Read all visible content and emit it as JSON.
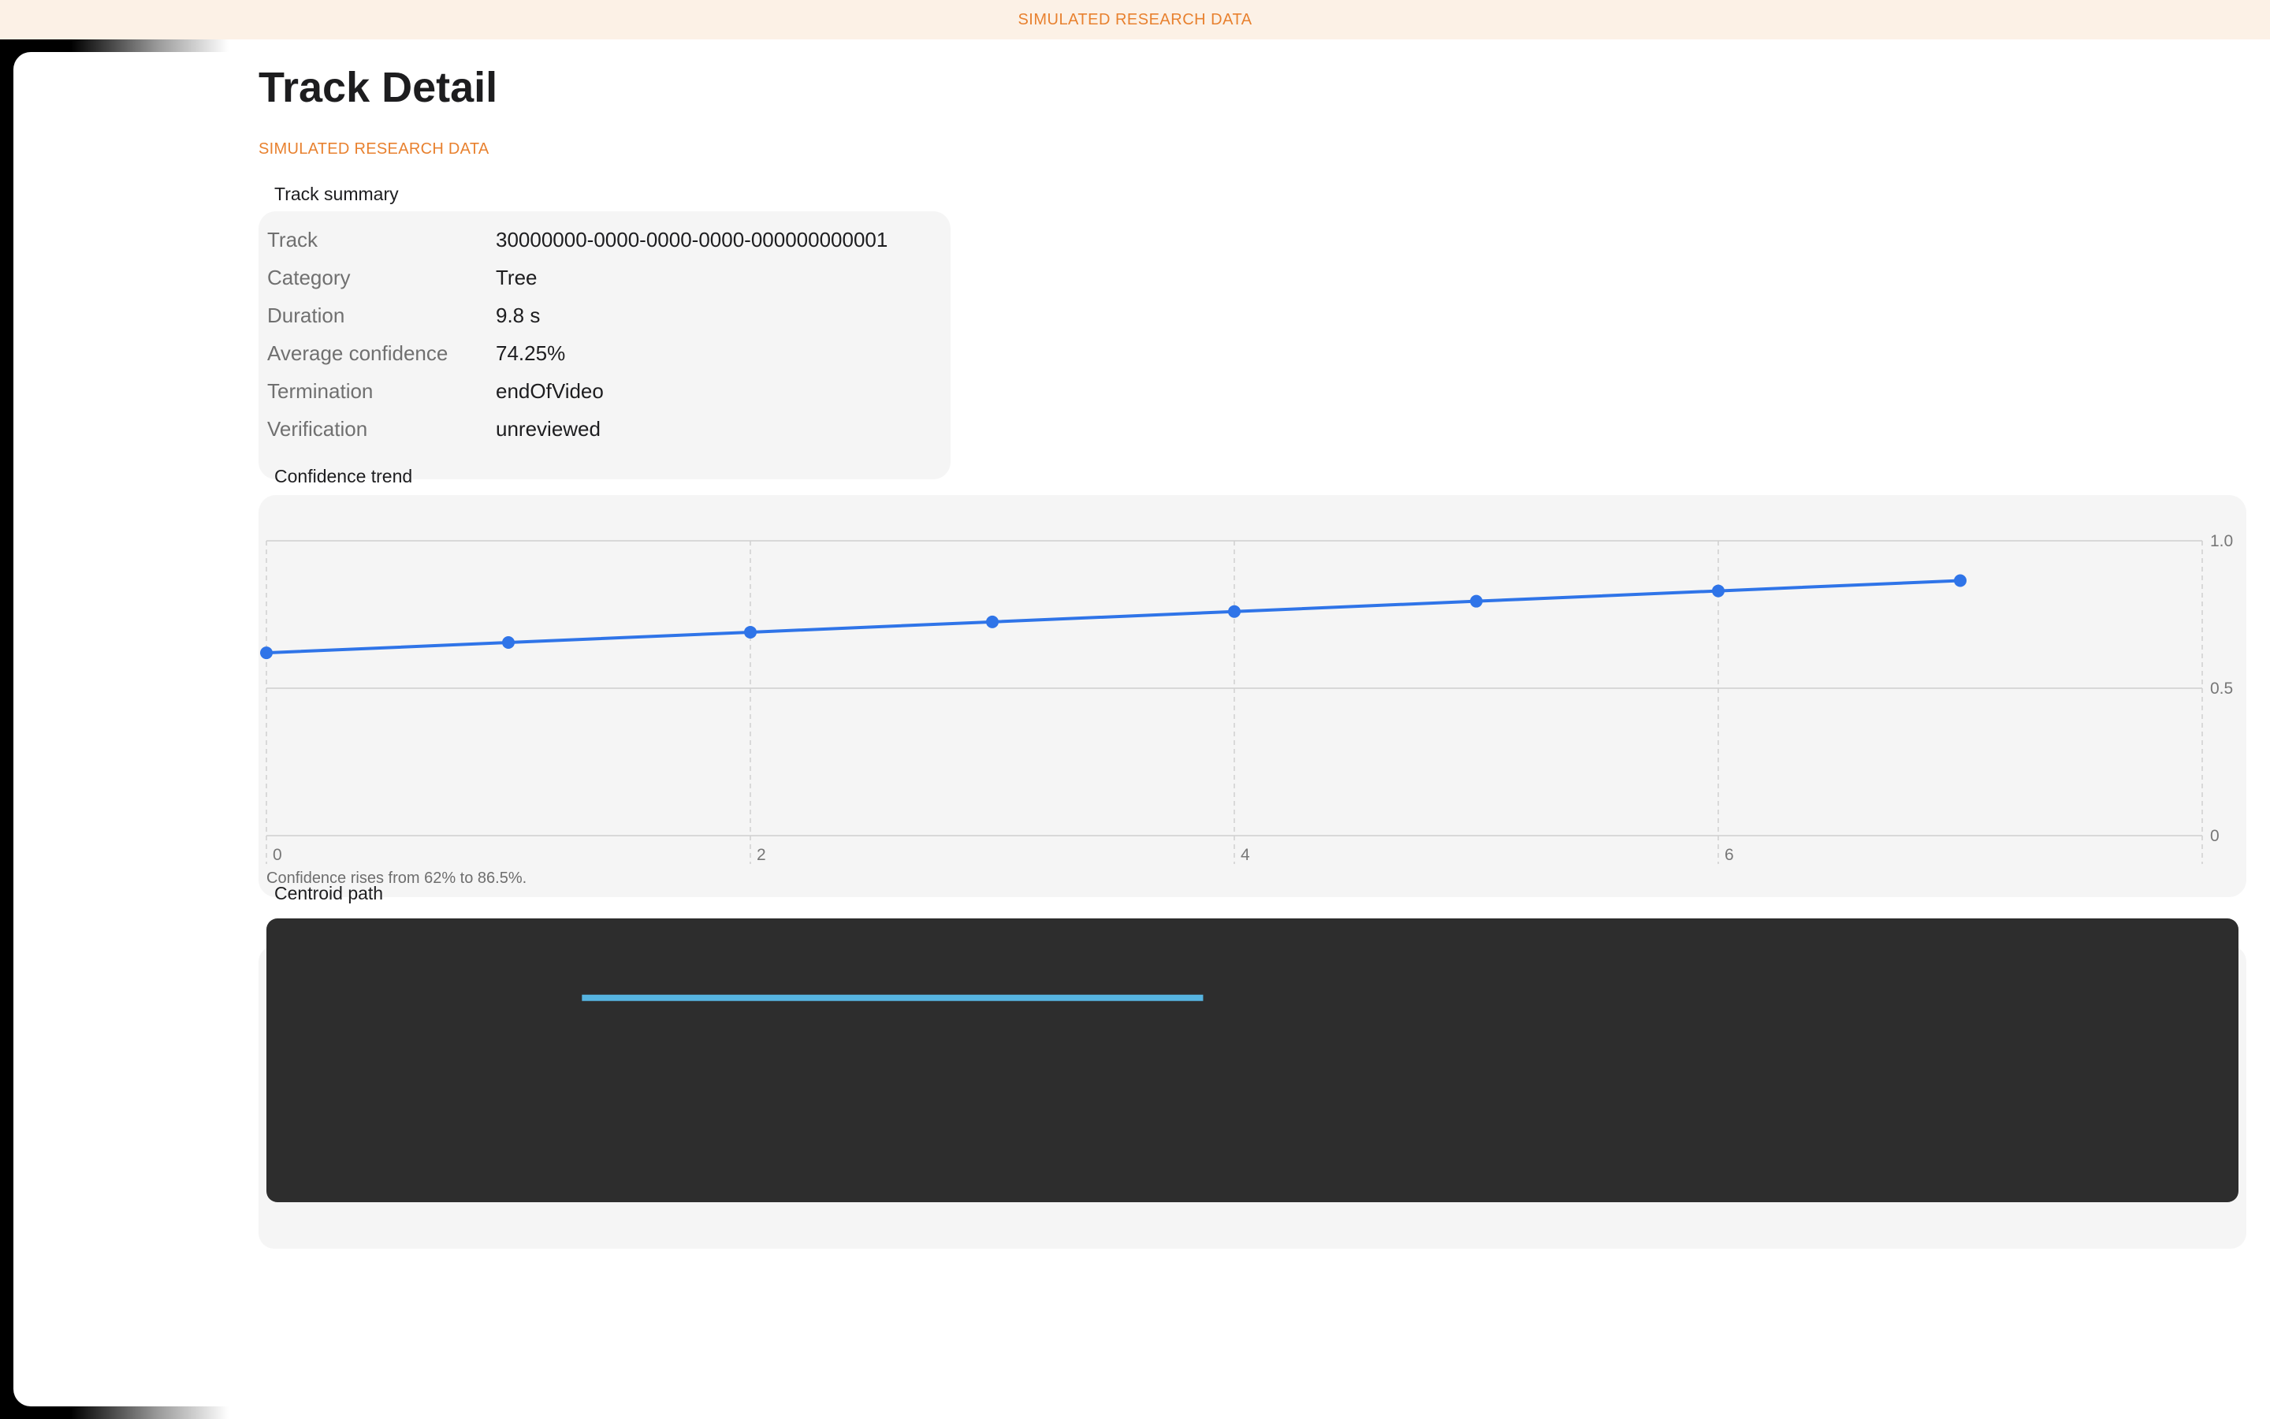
{
  "banner": "SIMULATED RESEARCH DATA",
  "page": {
    "title": "Track Detail",
    "sim_label": "SIMULATED RESEARCH DATA"
  },
  "summary": {
    "title": "Track summary",
    "rows": [
      {
        "key": "Track",
        "value": "30000000-0000-0000-0000-000000000001"
      },
      {
        "key": "Category",
        "value": "Tree"
      },
      {
        "key": "Duration",
        "value": "9.8 s"
      },
      {
        "key": "Average confidence",
        "value": "74.25%"
      },
      {
        "key": "Termination",
        "value": "endOfVideo"
      },
      {
        "key": "Verification",
        "value": "unreviewed"
      }
    ]
  },
  "trend": {
    "title": "Confidence trend",
    "caption": "Confidence rises from 62% to 86.5%.",
    "chart_data": {
      "type": "line",
      "x": [
        0,
        1,
        2,
        3,
        4,
        5,
        6,
        7
      ],
      "series": [
        {
          "values": [
            0.62,
            0.655,
            0.69,
            0.725,
            0.76,
            0.795,
            0.83,
            0.865
          ]
        }
      ],
      "xlim": [
        0,
        8
      ],
      "ylim": [
        0,
        1
      ],
      "x_ticks": [
        "0",
        "2",
        "4",
        "6"
      ],
      "y_ticks": [
        "1.0",
        "0.5",
        "0"
      ],
      "grid": true,
      "line_color": "#2f74e8"
    }
  },
  "path": {
    "title": "Centroid path",
    "chart_data": {
      "type": "line",
      "series": [
        {
          "x": [
            0.16,
            0.475
          ],
          "y": [
            0.72,
            0.72
          ]
        }
      ],
      "line_color": "#56b4e0",
      "background": "#2d2d2d"
    }
  }
}
